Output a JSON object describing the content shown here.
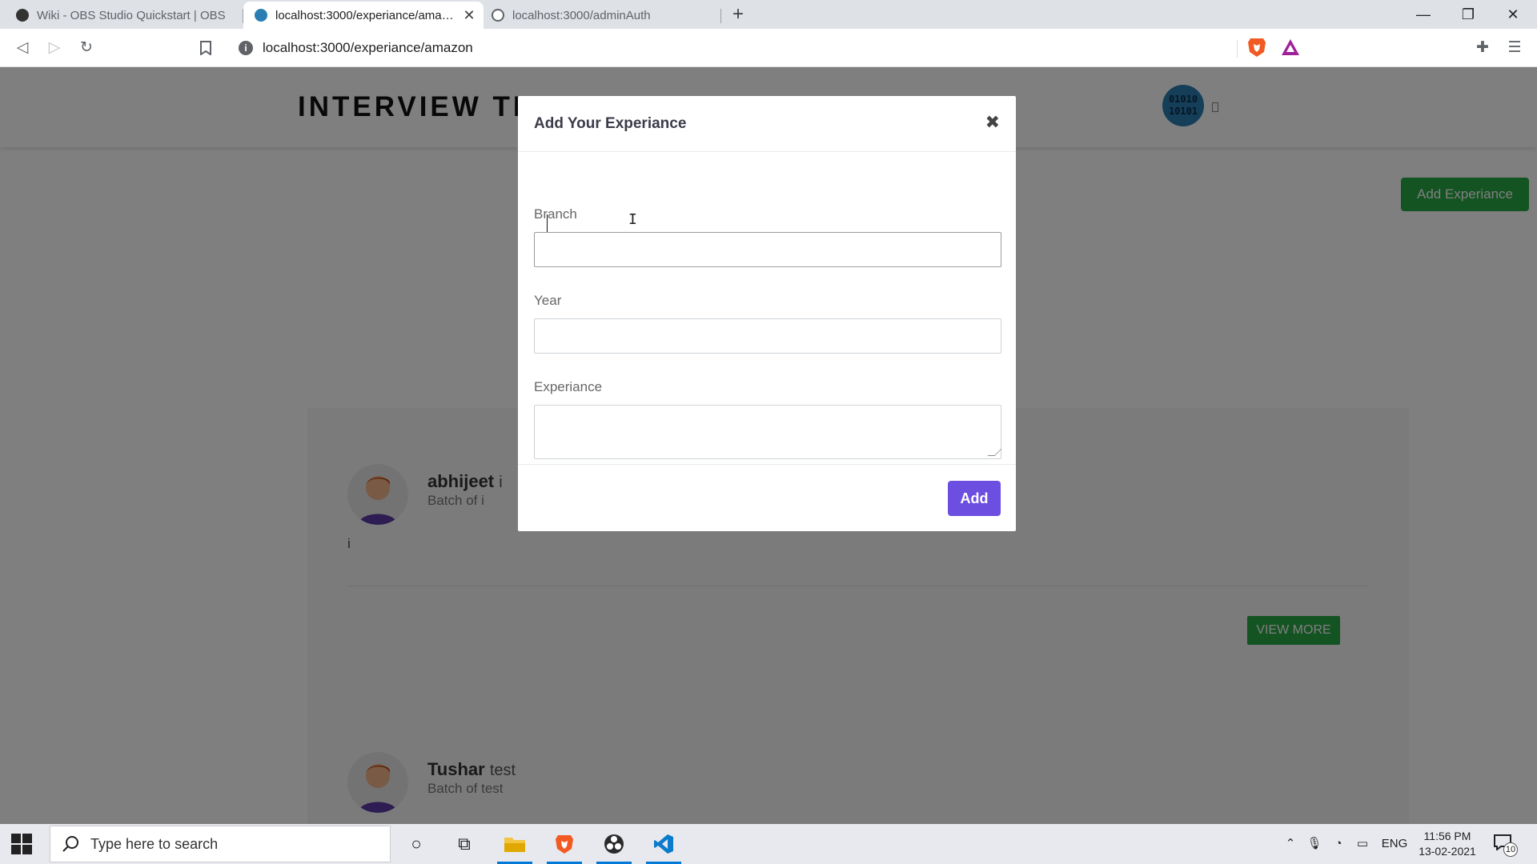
{
  "browser": {
    "tabs": [
      {
        "title": "Wiki - OBS Studio Quickstart | OBS",
        "active": false
      },
      {
        "title": "localhost:3000/experiance/amazon",
        "active": true
      },
      {
        "title": "localhost:3000/adminAuth",
        "active": false
      }
    ],
    "url": "localhost:3000/experiance/amazon"
  },
  "site": {
    "brand": "INTERVIEW TR",
    "add_button": "Add Experiance"
  },
  "cards": [
    {
      "name": "abhijeet",
      "branch": "i",
      "batch": "Batch of i",
      "text": "i",
      "view_more": "VIEW MORE"
    },
    {
      "name": "Tushar",
      "branch": "test",
      "batch": "Batch of test"
    }
  ],
  "modal": {
    "title": "Add Your Experiance",
    "close_icon": "close-icon",
    "fields": [
      {
        "label": "Branch",
        "value": ""
      },
      {
        "label": "Year",
        "value": ""
      },
      {
        "label": "Experiance",
        "value": ""
      }
    ],
    "submit": "Add"
  },
  "taskbar": {
    "search_placeholder": "Type here to search",
    "language": "ENG",
    "time": "11:56 PM",
    "date": "13-02-2021",
    "notification_count": "10"
  },
  "colors": {
    "success": "#28a745",
    "modal_primary": "#6c4ee0",
    "windows_accent": "#0078d7"
  }
}
